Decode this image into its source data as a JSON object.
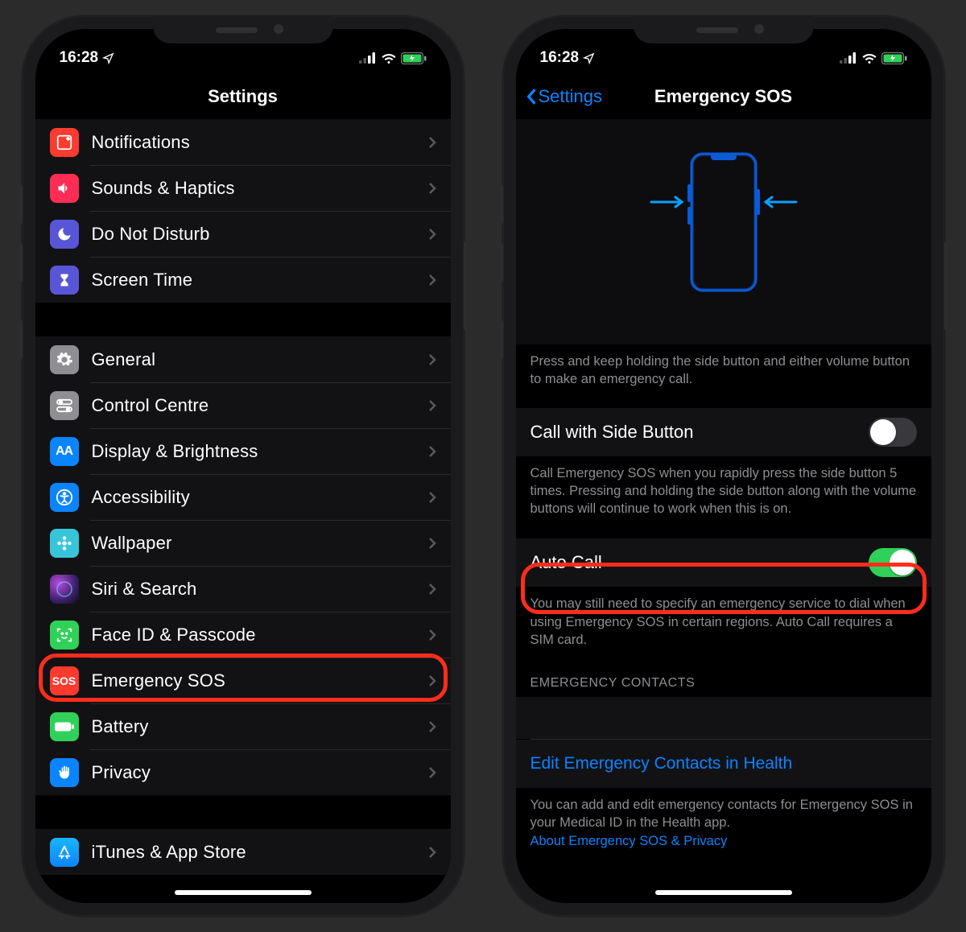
{
  "status": {
    "time": "16:28"
  },
  "left": {
    "title": "Settings",
    "groups": [
      [
        {
          "id": "notifications",
          "label": "Notifications",
          "bg": "#ff3b30"
        },
        {
          "id": "sounds",
          "label": "Sounds & Haptics",
          "bg": "#ff2d55"
        },
        {
          "id": "dnd",
          "label": "Do Not Disturb",
          "bg": "#5856d6"
        },
        {
          "id": "screentime",
          "label": "Screen Time",
          "bg": "#5856d6"
        }
      ],
      [
        {
          "id": "general",
          "label": "General",
          "bg": "#8e8e93"
        },
        {
          "id": "controlcentre",
          "label": "Control Centre",
          "bg": "#8e8e93"
        },
        {
          "id": "display",
          "label": "Display & Brightness",
          "bg": "#0a84ff"
        },
        {
          "id": "accessibility",
          "label": "Accessibility",
          "bg": "#0a84ff"
        },
        {
          "id": "wallpaper",
          "label": "Wallpaper",
          "bg": "#38c5d9"
        },
        {
          "id": "siri",
          "label": "Siri & Search",
          "bg": "#1c1c1e"
        },
        {
          "id": "faceid",
          "label": "Face ID & Passcode",
          "bg": "#30d158"
        },
        {
          "id": "sos",
          "label": "Emergency SOS",
          "bg": "#ff3b30",
          "badge": "SOS",
          "highlight": true
        },
        {
          "id": "battery",
          "label": "Battery",
          "bg": "#30d158"
        },
        {
          "id": "privacy",
          "label": "Privacy",
          "bg": "#0a84ff"
        }
      ],
      [
        {
          "id": "appstore",
          "label": "iTunes & App Store",
          "bg": "#0a84ff"
        }
      ]
    ]
  },
  "right": {
    "back": "Settings",
    "title": "Emergency SOS",
    "illus_caption": "Press and keep holding the side button and either volume button to make an emergency call.",
    "call_side": {
      "label": "Call with Side Button",
      "on": false
    },
    "call_side_caption": "Call Emergency SOS when you rapidly press the side button 5 times. Pressing and holding the side button along with the volume buttons will continue to work when this is on.",
    "auto_call": {
      "label": "Auto Call",
      "on": true,
      "highlight": true
    },
    "auto_call_caption": "You may still need to specify an emergency service to dial when using Emergency SOS in certain regions. Auto Call requires a SIM card.",
    "contacts_header": "EMERGENCY CONTACTS",
    "edit_link": "Edit Emergency Contacts in Health",
    "contacts_caption": "You can add and edit emergency contacts for Emergency SOS in your Medical ID in the Health app.",
    "privacy_link": "About Emergency SOS & Privacy"
  }
}
